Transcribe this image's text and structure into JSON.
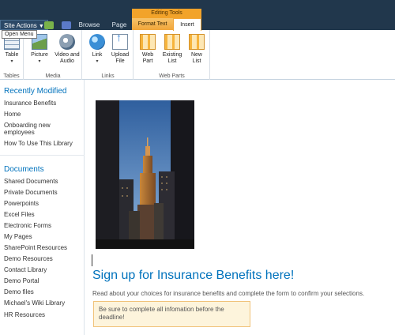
{
  "toolbar": {
    "site_actions_label": "Site Actions",
    "tooltip": "Open Menu",
    "tabs": [
      "Browse",
      "Page"
    ],
    "tool_group_label": "Editing Tools",
    "context_tabs": [
      "Format Text",
      "Insert"
    ],
    "selected_tab": "Insert"
  },
  "ribbon": {
    "groups": [
      {
        "label": "Tables",
        "buttons": [
          {
            "label": "Table",
            "icon": "table-icon"
          }
        ]
      },
      {
        "label": "Media",
        "buttons": [
          {
            "label": "Picture",
            "icon": "picture-icon"
          },
          {
            "label": "Video and Audio",
            "icon": "video-audio-icon"
          }
        ]
      },
      {
        "label": "Links",
        "buttons": [
          {
            "label": "Link",
            "icon": "link-globe-icon"
          },
          {
            "label": "Upload File",
            "icon": "upload-file-icon"
          }
        ]
      },
      {
        "label": "Web Parts",
        "buttons": [
          {
            "label": "Web Part",
            "icon": "web-part-icon"
          },
          {
            "label": "Existing List",
            "icon": "existing-list-icon"
          },
          {
            "label": "New List",
            "icon": "new-list-icon"
          }
        ]
      }
    ]
  },
  "leftnav": {
    "recently_modified": {
      "heading": "Recently Modified",
      "items": [
        "Insurance Benefits",
        "Home",
        "Onboarding new employees",
        "How To Use This Library"
      ]
    },
    "documents": {
      "heading": "Documents",
      "items": [
        "Shared Documents",
        "Private Documents",
        "Powerpoints",
        "Excel Files",
        "Electronic Forms",
        "My Pages",
        "SharePoint Resources",
        "Demo Resources",
        "Contact Library",
        "Demo Portal",
        "Demo files",
        "Michael's Wiki Library",
        "HR Resources"
      ]
    }
  },
  "content": {
    "headline": "Sign up for Insurance Benefits here!",
    "intro": "Read about your choices for insurance benefits and complete the form to confirm your selections.",
    "callout": "Be sure to complete all infomation before the deadline!"
  },
  "colors": {
    "topbar": "#21374c",
    "accent_blue": "#0072bc",
    "editing_tools_orange": "#f2a32a",
    "callout_bg": "#fdf4dc"
  }
}
